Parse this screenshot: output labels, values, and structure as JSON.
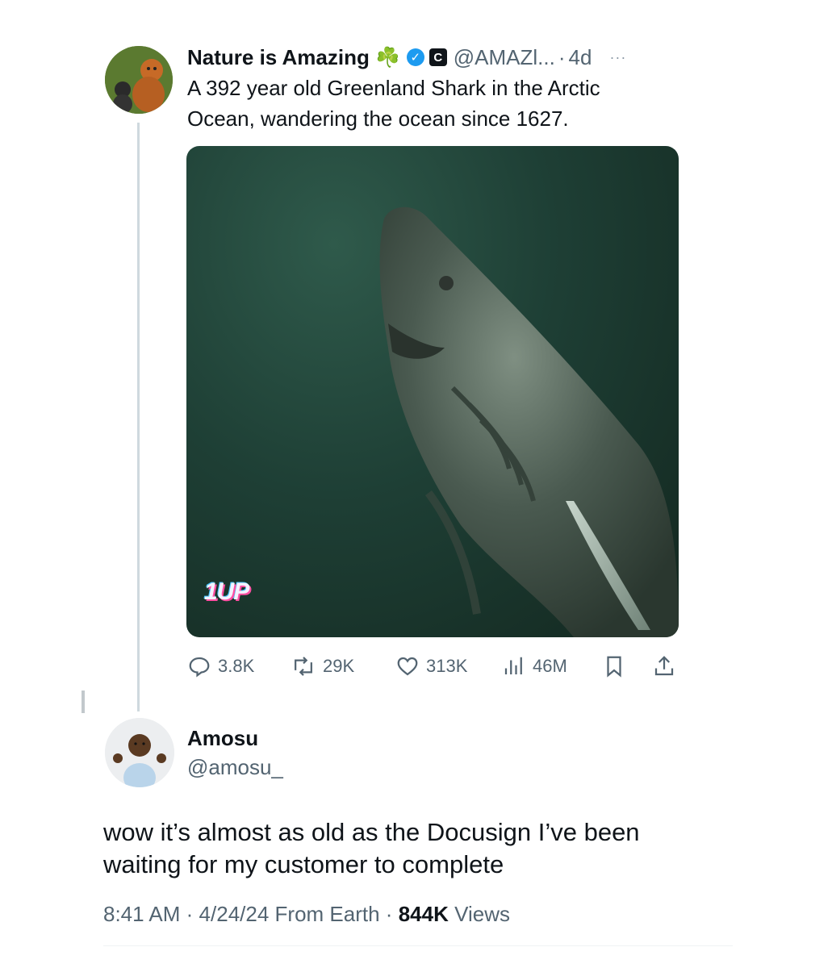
{
  "quoted_tweet": {
    "display_name": "Nature is Amazing",
    "emoji": "☘️",
    "org_badge_letter": "C",
    "handle": "@AMAZl...",
    "separator": "·",
    "time": "4d",
    "more": "···",
    "text": "A 392 year old Greenland Shark in the Arctic Ocean, wandering the ocean since 1627.",
    "media_watermark": "1UP",
    "stats": {
      "replies": "3.8K",
      "reposts": "29K",
      "likes": "313K",
      "views": "46M"
    }
  },
  "reply": {
    "display_name": "Amosu",
    "handle": "@amosu_",
    "text": "wow it’s almost as old as the Docusign I’ve been waiting for my customer to complete",
    "time": "8:41 AM",
    "date": "4/24/24",
    "source": "From Earth",
    "views_count": "844K",
    "views_label": "Views",
    "separator": "·"
  },
  "colors": {
    "text_primary": "#0f1419",
    "text_secondary": "#536471",
    "verified_blue": "#1d9bf0",
    "thread_line": "#cfd9de"
  },
  "icons": [
    "reply-icon",
    "repost-icon",
    "like-icon",
    "views-icon",
    "bookmark-icon",
    "share-icon",
    "verified-icon",
    "clover-icon",
    "org-badge-icon",
    "more-icon"
  ]
}
